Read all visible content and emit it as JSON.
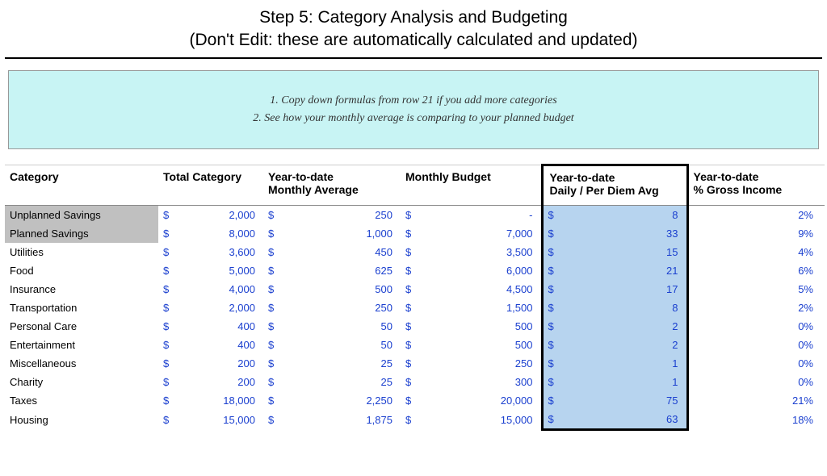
{
  "header": {
    "title_line1": "Step 5: Category Analysis and Budgeting",
    "title_line2": "(Don't Edit: these are automatically calculated and updated)"
  },
  "info": {
    "line1": "1. Copy down formulas from row 21 if you add more categories",
    "line2": "2. See how your monthly average is comparing to your planned budget"
  },
  "columns": {
    "category": "Category",
    "total": "Total Category",
    "avg": "Year-to-date\nMonthly Average",
    "budget": "Monthly Budget",
    "perdiem": "Year-to-date\nDaily / Per Diem Avg",
    "gross": "Year-to-date\n% Gross Income"
  },
  "rows": [
    {
      "category": "Unplanned Savings",
      "total": "2,000",
      "avg": "250",
      "budget": "-",
      "perdiem": "8",
      "gross": "2%",
      "shade": true
    },
    {
      "category": "Planned Savings",
      "total": "8,000",
      "avg": "1,000",
      "budget": "7,000",
      "perdiem": "33",
      "gross": "9%",
      "shade": true
    },
    {
      "category": "Utilities",
      "total": "3,600",
      "avg": "450",
      "budget": "3,500",
      "perdiem": "15",
      "gross": "4%",
      "shade": false
    },
    {
      "category": "Food",
      "total": "5,000",
      "avg": "625",
      "budget": "6,000",
      "perdiem": "21",
      "gross": "6%",
      "shade": false
    },
    {
      "category": "Insurance",
      "total": "4,000",
      "avg": "500",
      "budget": "4,500",
      "perdiem": "17",
      "gross": "5%",
      "shade": false
    },
    {
      "category": "Transportation",
      "total": "2,000",
      "avg": "250",
      "budget": "1,500",
      "perdiem": "8",
      "gross": "2%",
      "shade": false
    },
    {
      "category": "Personal Care",
      "total": "400",
      "avg": "50",
      "budget": "500",
      "perdiem": "2",
      "gross": "0%",
      "shade": false
    },
    {
      "category": "Entertainment",
      "total": "400",
      "avg": "50",
      "budget": "500",
      "perdiem": "2",
      "gross": "0%",
      "shade": false
    },
    {
      "category": "Miscellaneous",
      "total": "200",
      "avg": "25",
      "budget": "250",
      "perdiem": "1",
      "gross": "0%",
      "shade": false
    },
    {
      "category": "Charity",
      "total": "200",
      "avg": "25",
      "budget": "300",
      "perdiem": "1",
      "gross": "0%",
      "shade": false
    },
    {
      "category": "Taxes",
      "total": "18,000",
      "avg": "2,250",
      "budget": "20,000",
      "perdiem": "75",
      "gross": "21%",
      "shade": false
    },
    {
      "category": "Housing",
      "total": "15,000",
      "avg": "1,875",
      "budget": "15,000",
      "perdiem": "63",
      "gross": "18%",
      "shade": false
    }
  ]
}
